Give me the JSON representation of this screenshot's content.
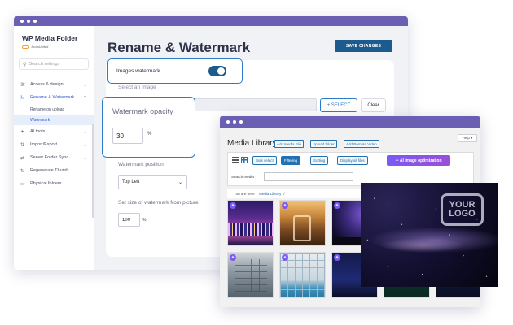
{
  "app": {
    "brand": "WP Media Folder",
    "brand_sub": "JoomUnited"
  },
  "sidebar": {
    "search_placeholder": "Search settings",
    "items": [
      {
        "label": "Access & design",
        "icon": "grid-icon"
      },
      {
        "label": "Rename & Watermark",
        "icon": "rename-icon"
      },
      {
        "label": "AI tools",
        "icon": "ai-icon"
      },
      {
        "label": "Import/Export",
        "icon": "import-export-icon"
      },
      {
        "label": "Server Folder Sync",
        "icon": "sync-icon"
      },
      {
        "label": "Regenerate Thumb",
        "icon": "refresh-icon"
      },
      {
        "label": "Physical folders",
        "icon": "folder-icon"
      }
    ],
    "subitems": [
      "Rename on upload",
      "Watermark"
    ]
  },
  "main": {
    "title": "Rename & Watermark",
    "save_label": "SAVE CHANGES",
    "images_watermark_label": "Images watermark",
    "select_image_label": "Select an image",
    "select_btn": "+ SELECT",
    "clear_btn": "Clear",
    "opacity_label": "Watermark opacity",
    "opacity_value": "30",
    "percent": "%",
    "position_label": "Watermark position",
    "position_value": "Top Left",
    "size_label": "Set size of watermark from picture",
    "size_value": "100"
  },
  "media": {
    "help": "Help ▾",
    "title": "Media Library",
    "add_media": "Add Media File",
    "upload_folder": "Upload folder",
    "add_remote": "Add Remote Video",
    "bulk_select": "Bulk select",
    "filtering": "Filtering",
    "sorting": "Sorting",
    "display_all": "Display all files",
    "ai_optimization": "AI image optimization",
    "search_label": "Search media",
    "you_are_here": "You are here :",
    "crumb": "Media Library",
    "crumb_sep": "/"
  },
  "preview": {
    "logo_line1": "YOUR",
    "logo_line2": "LOGO"
  },
  "colors": {
    "accent": "#1d5a8e",
    "highlight": "#2a7cc7",
    "titlebar": "#6b5fb4",
    "ai": "#7a5af5"
  }
}
